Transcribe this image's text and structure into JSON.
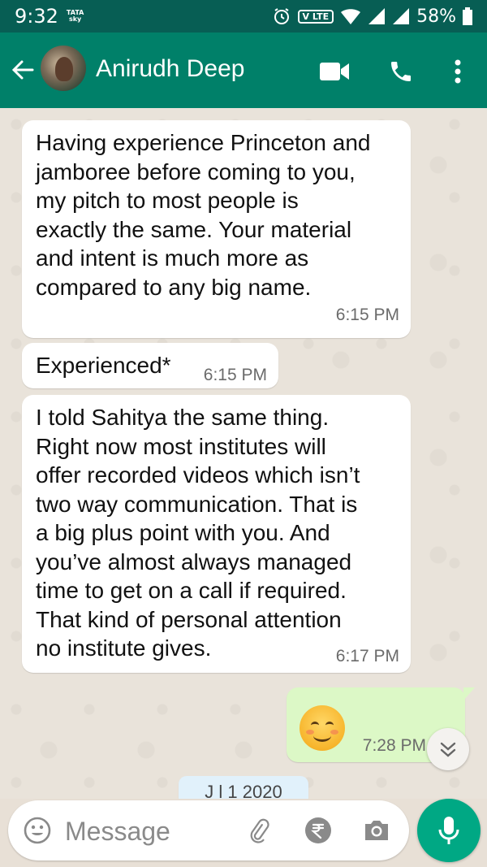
{
  "status_bar": {
    "time": "9:32",
    "carrier_line1": "TATA",
    "carrier_line2": "sky",
    "volte": "V LTE",
    "battery": "58%"
  },
  "header": {
    "contact_name": "Anirudh Deep",
    "icons": [
      "back-arrow-icon",
      "video-call-icon",
      "phone-icon",
      "more-vert-icon"
    ]
  },
  "messages": [
    {
      "direction": "incoming",
      "text": "Having experience Princeton and\njamboree before coming to you,\nmy pitch to most people is\nexactly the same. Your material\nand intent is much more as\ncompared to any big name.",
      "time": "6:15 PM"
    },
    {
      "direction": "incoming",
      "text": "Experienced*",
      "time": "6:15 PM"
    },
    {
      "direction": "incoming",
      "text": "I told Sahitya the same thing.\nRight now most institutes will\noffer recorded videos which isn’t\ntwo way communication. That is\na big plus point with you. And\nyou’ve almost always managed\ntime to get on a call if required.\nThat kind of personal attention\nno institute gives.",
      "time": "6:17 PM"
    },
    {
      "direction": "outgoing",
      "emoji": "smiling-face-icon",
      "time": "7:28 PM"
    }
  ],
  "date_chip": "J l 1 2020",
  "composer": {
    "placeholder": "Message",
    "icons": [
      "emoji-icon",
      "attach-icon",
      "rupee-icon",
      "camera-icon",
      "mic-icon"
    ]
  },
  "colors": {
    "header": "#008069",
    "status_bar": "#075e54",
    "outgoing_bubble": "#dcf8c6",
    "mic_button": "#00a884"
  }
}
